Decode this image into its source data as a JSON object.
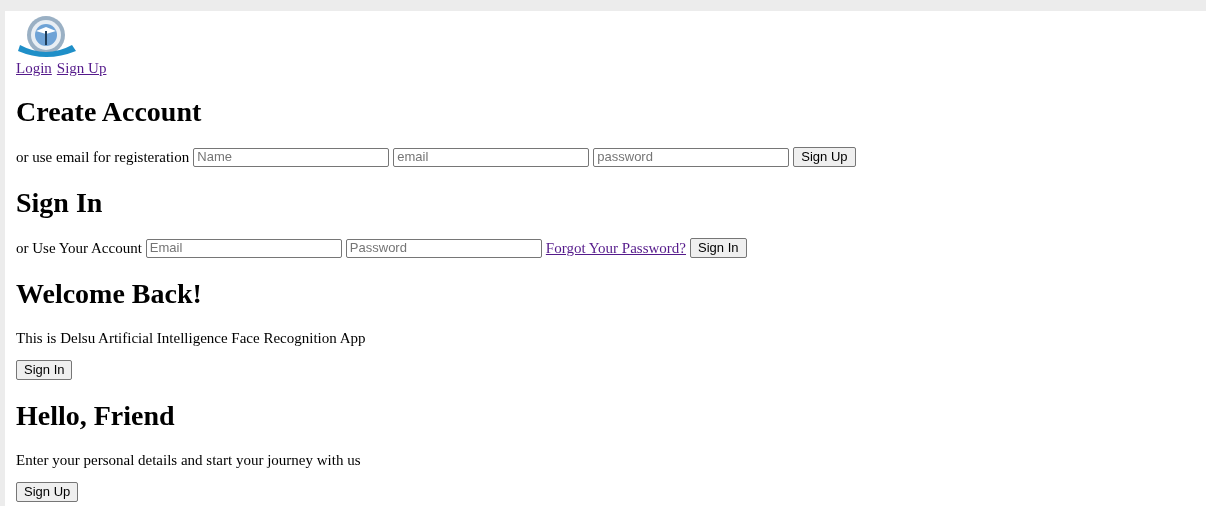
{
  "nav_links": [
    "Login",
    "Sign Up"
  ],
  "sections": [
    {
      "heading": "Create Account",
      "kind": "form",
      "label": "or use email for registeration",
      "fields": [
        {
          "placeholder": "Name"
        },
        {
          "placeholder": "email"
        },
        {
          "placeholder": "password"
        }
      ],
      "button": "Sign Up"
    },
    {
      "heading": "Sign In",
      "kind": "form",
      "label": "or Use Your Account",
      "fields": [
        {
          "placeholder": "Email"
        },
        {
          "placeholder": "Password"
        }
      ],
      "link": "Forgot Your Password?",
      "button": "Sign In"
    },
    {
      "heading": "Welcome Back!",
      "kind": "panel",
      "text": "This is Delsu Artificial Intelligence Face Recognition App",
      "button": "Sign In"
    },
    {
      "heading": "Hello, Friend",
      "kind": "panel",
      "text": "Enter your personal details and start your journey with us",
      "button": "Sign Up"
    }
  ]
}
